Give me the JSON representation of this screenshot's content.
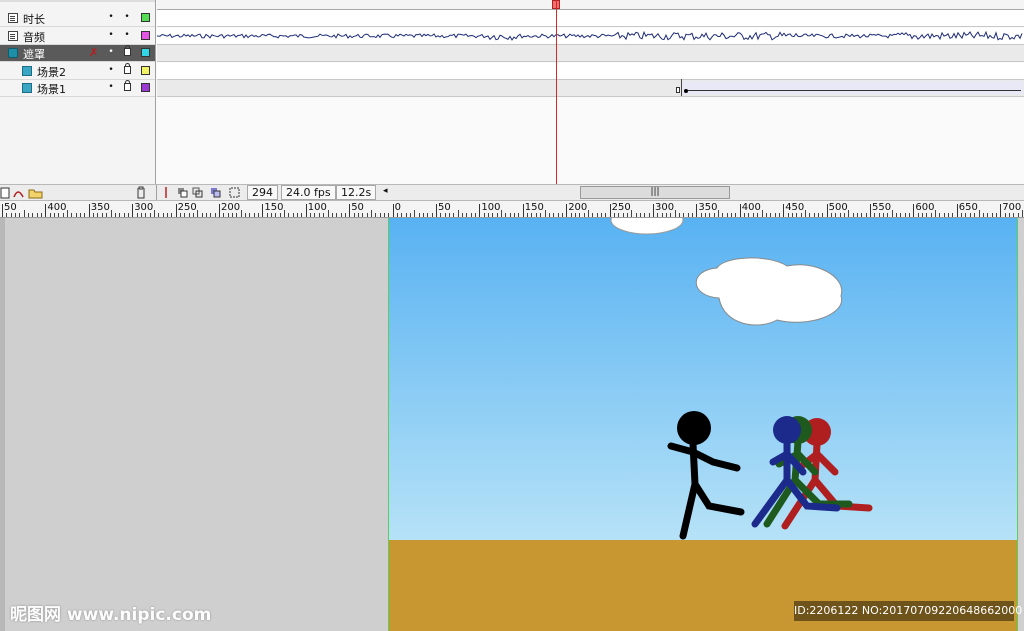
{
  "timeline": {
    "layers": [
      {
        "name": "时长",
        "type": "normal",
        "color": "#55dd55",
        "selected": false
      },
      {
        "name": "音频",
        "type": "normal",
        "color": "#e455e4",
        "selected": false
      },
      {
        "name": "遮罩",
        "type": "mask",
        "color": "#33d6e6",
        "selected": true
      },
      {
        "name": "场景2",
        "type": "masked",
        "color": "#f2f266",
        "selected": false
      },
      {
        "name": "场景1",
        "type": "masked",
        "color": "#9a3ad2",
        "selected": false
      }
    ],
    "current_frame": "294",
    "frame_rate": "24.0 fps",
    "elapsed_time": "12.2s"
  },
  "ruler": {
    "labels": [
      "50",
      "400",
      "350",
      "300",
      "250",
      "200",
      "150",
      "100",
      "50",
      "0",
      "50",
      "100",
      "150",
      "200",
      "250",
      "300",
      "350",
      "400",
      "450",
      "500",
      "550",
      "600",
      "650",
      "700"
    ]
  },
  "watermark": {
    "left_text": "昵图网 www.nipic.com",
    "right_text": "ID:2206122 NO:20170709220648662000"
  },
  "colors": {
    "sky_top": "#58b2f2",
    "sky_bottom": "#b6e2f7",
    "ground": "#c99731",
    "stage_border": "#5ad05a",
    "playhead": "#d32b2b",
    "figure_black": "#000000",
    "figure_navy": "#1c2a8c",
    "figure_green": "#1e5a1e",
    "figure_red": "#b01f1f"
  }
}
